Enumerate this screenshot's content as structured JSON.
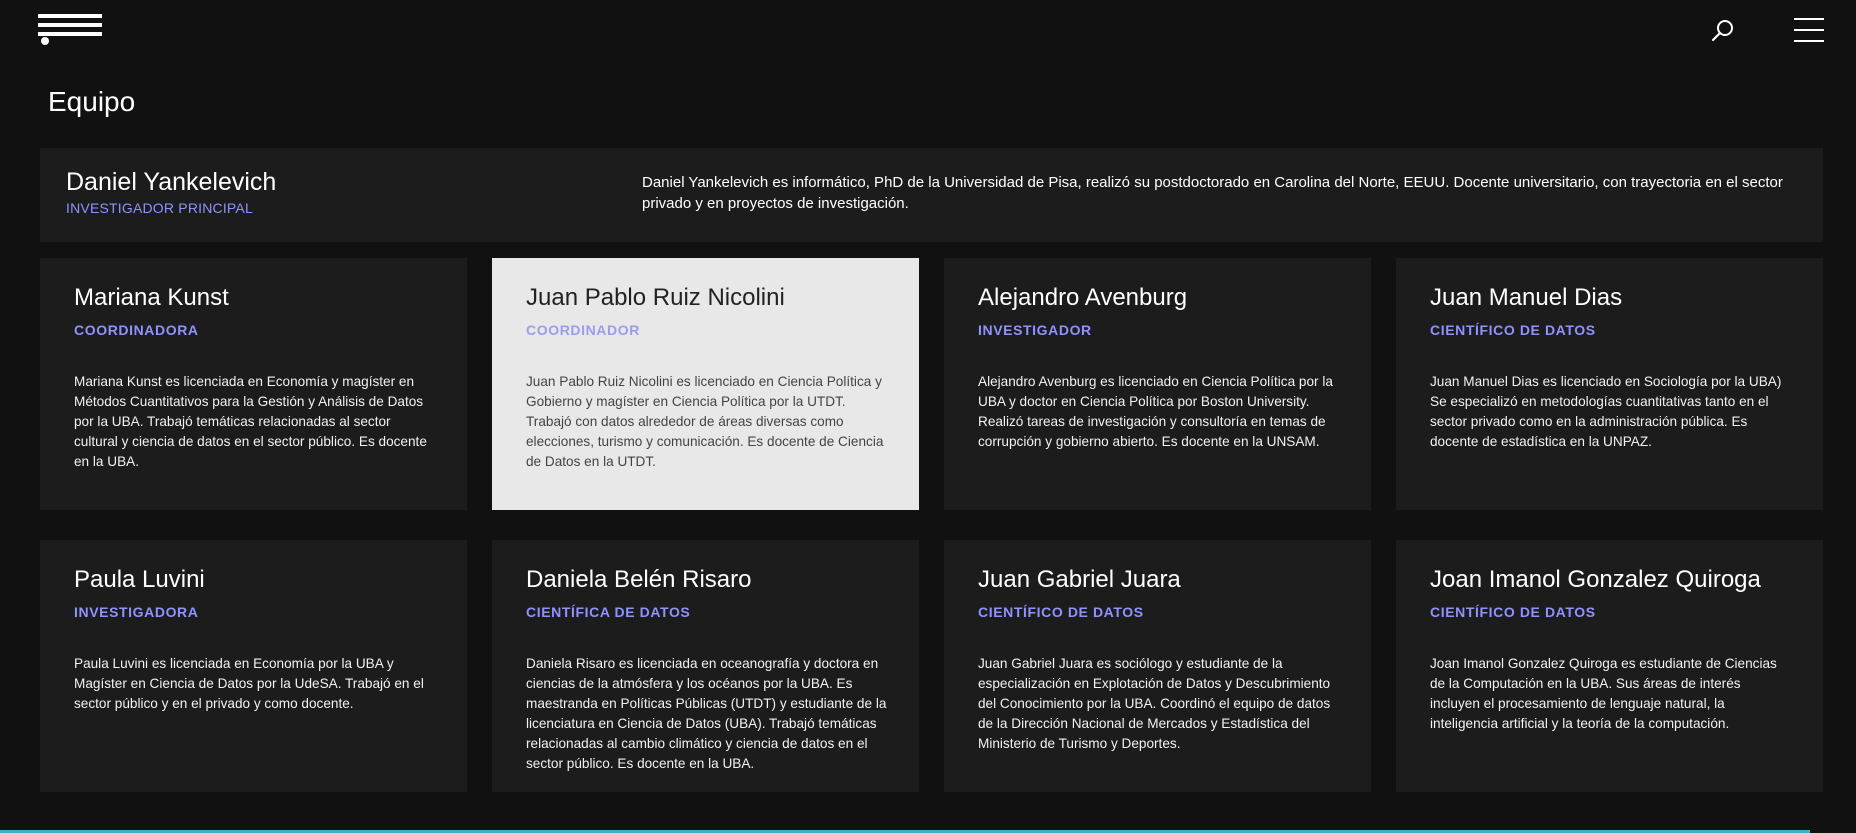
{
  "header": {
    "logo_icon": "logo-lines-icon",
    "search_icon": "search-icon",
    "menu_icon": "hamburger-menu-icon"
  },
  "page": {
    "title": "Equipo"
  },
  "featured": {
    "name": "Daniel Yankelevich",
    "role": "INVESTIGADOR PRINCIPAL",
    "bio": "Daniel Yankelevich es informático, PhD de la Universidad de Pisa, realizó su postdoctorado en Carolina del Norte, EEUU. Docente universitario, con trayectoria en el sector privado y en proyectos de investigación."
  },
  "members": [
    {
      "name": "Mariana Kunst",
      "role": "COORDINADORA",
      "bio": "Mariana Kunst es licenciada en Economía y magíster en Métodos Cuantitativos para la Gestión y Análisis de Datos por la UBA. Trabajó temáticas relacionadas al sector cultural y ciencia de datos en el sector público. Es docente en la UBA."
    },
    {
      "name": "Juan Pablo Ruiz Nicolini",
      "role": "COORDINADOR",
      "bio": "Juan Pablo Ruiz Nicolini es licenciado en Ciencia Política y Gobierno y magíster en Ciencia Política por la UTDT. Trabajó con datos alrededor de áreas diversas como elecciones, turismo y comunicación. Es docente de Ciencia de Datos en la UTDT."
    },
    {
      "name": "Alejandro Avenburg",
      "role": "INVESTIGADOR",
      "bio": "Alejandro Avenburg es licenciado en Ciencia Política por la UBA y doctor en Ciencia Política por Boston University. Realizó tareas de investigación y consultoría en temas de corrupción y gobierno abierto. Es docente en la UNSAM."
    },
    {
      "name": "Juan Manuel Dias",
      "role": "CIENTÍFICO DE DATOS",
      "bio": "Juan Manuel Dias es licenciado en Sociología por la UBA) Se especializó en metodologías cuantitativas tanto en el sector privado como en la administración pública. Es docente de estadística en la UNPAZ."
    },
    {
      "name": "Paula Luvini",
      "role": "INVESTIGADORA",
      "bio": "Paula Luvini es licenciada en Economía por la UBA y Magíster en Ciencia de Datos por la UdeSA. Trabajó en el sector público y en el privado y como docente."
    },
    {
      "name": "Daniela Belén Risaro",
      "role": "CIENTÍFICA DE DATOS",
      "bio": "Daniela Risaro es licenciada en oceanografía y doctora en ciencias de la atmósfera y los océanos por la UBA. Es maestranda en Políticas Públicas (UTDT) y estudiante de la licenciatura en Ciencia de Datos (UBA). Trabajó temáticas relacionadas al cambio climático y ciencia de datos en el sector público. Es docente en la UBA."
    },
    {
      "name": "Juan Gabriel Juara",
      "role": "CIENTÍFICO DE DATOS",
      "bio": "Juan Gabriel Juara es sociólogo y estudiante de la especialización en Explotación de Datos y Descubrimiento del Conocimiento por la UBA. Coordinó el equipo de datos de la Dirección Nacional de Mercados y Estadística del Ministerio de Turismo y Deportes."
    },
    {
      "name": "Joan Imanol Gonzalez Quiroga",
      "role": "CIENTÍFICO DE DATOS",
      "bio": "Joan Imanol Gonzalez Quiroga es estudiante de Ciencias de la Computación en la UBA. Sus áreas de interés incluyen el procesamiento de lenguaje natural, la inteligencia artificial y la teoría de la computación."
    }
  ],
  "colors": {
    "background": "#111111",
    "card": "#1c1c1c",
    "card_highlight": "#e8e8e8",
    "accent": "#8f92ff",
    "bottom_line": "#3fb0c9"
  }
}
